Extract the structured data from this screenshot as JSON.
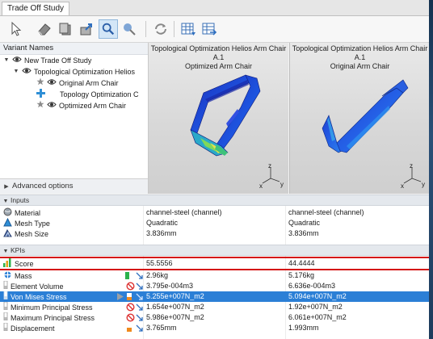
{
  "window": {
    "tab_title": "Trade Off Study"
  },
  "toolbar": {
    "icons": [
      "select-arrow-icon",
      "eraser-icon",
      "copy-icon",
      "export-icon",
      "zoom-fit-icon",
      "pan-icon",
      "refresh-cycle-icon",
      "table-view-icon",
      "table-export-icon"
    ],
    "active_icon": "zoom-fit-icon"
  },
  "variants": {
    "header": "Variant Names",
    "items": [
      {
        "label": "New Trade Off Study",
        "level": 0,
        "expanded": true,
        "icon": "eye-icon"
      },
      {
        "label": "Topological Optimization Helios",
        "level": 1,
        "expanded": true,
        "icon": "eye-icon"
      },
      {
        "label": "Original Arm Chair",
        "level": 2,
        "icon": "star-eye-icon"
      },
      {
        "label": "Topology Optimization C",
        "level": 2,
        "icon": "plus-shape-icon"
      },
      {
        "label": "Optimized Arm Chair",
        "level": 2,
        "icon": "star-eye-icon"
      }
    ],
    "advanced_label": "Advanced options"
  },
  "viewports": [
    {
      "title_line1": "Topological Optimization Helios Arm Chair A.1",
      "title_line2": "Optimized Arm Chair"
    },
    {
      "title_line1": "Topological Optimization Helios Arm Chair A.1",
      "title_line2": "Original Arm Chair"
    }
  ],
  "axes_labels": {
    "z": "z",
    "x": "x",
    "y": "y"
  },
  "inputs": {
    "section_label": "Inputs",
    "rows": [
      {
        "name": "Material",
        "icon": "material-sphere-icon",
        "v1": "channel-steel (channel)",
        "v2": "channel-steel (channel)"
      },
      {
        "name": "Mesh Type",
        "icon": "mesh-type-icon",
        "v1": "Quadratic",
        "v2": "Quadratic"
      },
      {
        "name": "Mesh Size",
        "icon": "mesh-size-icon",
        "v1": "3.836mm",
        "v2": "3.836mm"
      }
    ]
  },
  "kpis": {
    "section_label": "KPIs",
    "score": {
      "name": "Score",
      "v1": "55.5556",
      "v2": "44.4444"
    },
    "rows": [
      {
        "name": "Mass",
        "icon": "mass-icon",
        "v1": "2.96kg",
        "v2": "5.176kg",
        "indicators": [
          "green-bar"
        ],
        "trend": "down"
      },
      {
        "name": "Element Volume",
        "icon": "kpi-bar-icon",
        "v1": "3.795e-004m3",
        "v2": "6.636e-004m3",
        "indicators": [
          "not-allowed"
        ],
        "trend": "down"
      },
      {
        "name": "Von Mises Stress",
        "icon": "kpi-bar-icon",
        "v1": "5.255e+007N_m2",
        "v2": "5.094e+007N_m2",
        "indicators": [
          "play",
          "orange-bar"
        ],
        "trend": "down",
        "selected": true
      },
      {
        "name": "Minimum Principal Stress",
        "icon": "kpi-bar-icon",
        "v1": "1.654e+007N_m2",
        "v2": "1.92e+007N_m2",
        "indicators": [
          "not-allowed"
        ],
        "trend": "down"
      },
      {
        "name": "Maximum Principal Stress",
        "icon": "kpi-bar-icon",
        "v1": "5.986e+007N_m2",
        "v2": "6.061e+007N_m2",
        "indicators": [
          "not-allowed"
        ],
        "trend": "down"
      },
      {
        "name": "Displacement",
        "icon": "kpi-bar-icon",
        "v1": "3.765mm",
        "v2": "1.993mm",
        "indicators": [
          "orange-bar"
        ],
        "trend": "down"
      }
    ]
  },
  "colors": {
    "selection": "#2b7fd6",
    "score_outline": "#d41414",
    "trend_arrow": "#2f6fbf",
    "not_allowed": "#d33",
    "good": "#2bb24c",
    "warn": "#f08a1c"
  }
}
